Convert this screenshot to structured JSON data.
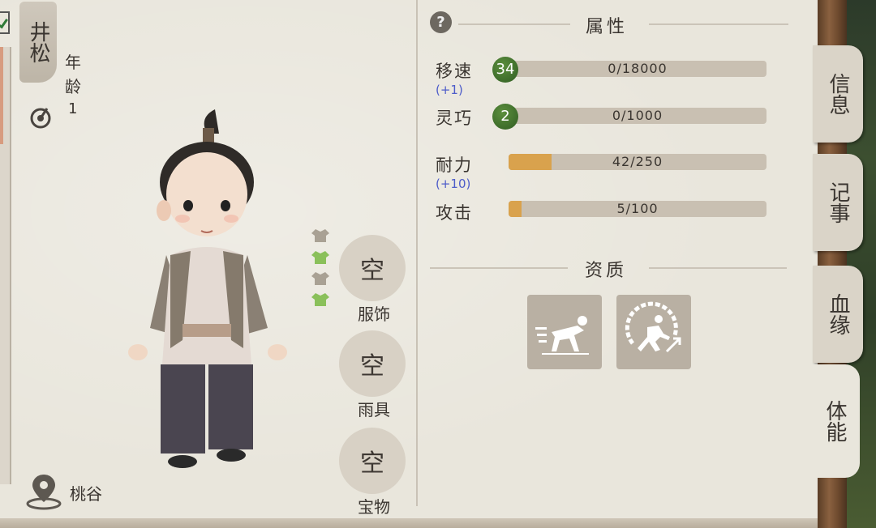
{
  "character": {
    "name": "井松",
    "age_label": "年龄",
    "age_value": "1",
    "location": "桃谷"
  },
  "equipment": {
    "slots": [
      {
        "value": "空",
        "label": "服饰"
      },
      {
        "value": "空",
        "label": "雨具"
      },
      {
        "value": "空",
        "label": "宝物"
      }
    ]
  },
  "attributes": {
    "help": "?",
    "title": "属性",
    "stats": [
      {
        "label": "移速",
        "level": "34",
        "value": "0/18000",
        "progress": 0,
        "bonus": "(+1)"
      },
      {
        "label": "灵巧",
        "level": "2",
        "value": "0/1000",
        "progress": 0
      },
      {
        "label": "耐力",
        "value": "42/250",
        "progress": 0.168,
        "bonus": "(+10)"
      },
      {
        "label": "攻击",
        "value": "5/100",
        "progress": 0.05
      }
    ]
  },
  "aptitude": {
    "title": "资质",
    "traits": [
      "sprint-start-icon",
      "speed-runner-icon"
    ]
  },
  "tabs": [
    {
      "label": "信息",
      "active": false
    },
    {
      "label": "记事",
      "active": false
    },
    {
      "label": "血缘",
      "active": false
    },
    {
      "label": "体能",
      "active": true
    }
  ],
  "colors": {
    "paper": "#e9e6dc",
    "bar_fill": "#d9a24d",
    "level_badge": "#3f6e2b",
    "bonus_text": "#4d5cc9"
  }
}
